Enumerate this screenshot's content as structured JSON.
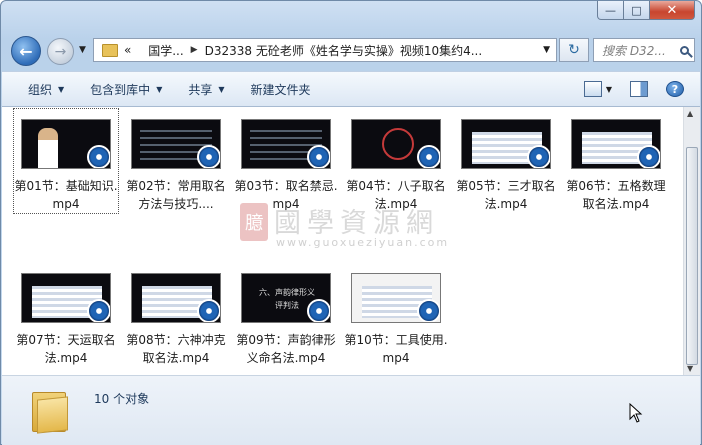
{
  "window": {
    "buttons": {
      "minimize": "—",
      "maximize": "□",
      "close": "✕"
    }
  },
  "nav": {
    "back_icon": "back-arrow-icon",
    "forward_icon": "forward-arrow-icon",
    "breadcrumb_prefix": "«",
    "crumbs": [
      "国学...",
      "D32338 无砼老师《姓名学与实操》视频10集约4..."
    ],
    "search_placeholder": "搜索 D32..."
  },
  "toolbar": {
    "organize": "组织",
    "include_library": "包含到库中",
    "share": "共享",
    "new_folder": "新建文件夹"
  },
  "files": [
    {
      "label": "第01节：基础知识.mp4",
      "style": "person"
    },
    {
      "label": "第02节：常用取名方法与技巧....",
      "style": "text"
    },
    {
      "label": "第03节：取名禁忌.mp4",
      "style": "text"
    },
    {
      "label": "第04节：八子取名法.mp4",
      "style": "circle"
    },
    {
      "label": "第05节：三才取名法.mp4",
      "style": "table"
    },
    {
      "label": "第06节：五格数理取名法.mp4",
      "style": "table"
    },
    {
      "label": "第07节：天运取名法.mp4",
      "style": "table"
    },
    {
      "label": "第08节：六神冲克取名法.mp4",
      "style": "table"
    },
    {
      "label": "第09节：声韵律形义命名法.mp4",
      "style": "title"
    },
    {
      "label": "第10节：工具使用.mp4",
      "style": "light"
    }
  ],
  "thumb_title_text": "六、声韵律形义\n评判法",
  "watermark": {
    "seal": "臆",
    "chinese": "國學資源網",
    "url": "www.guoxueziyuan.com"
  },
  "status": {
    "count": "10 个对象"
  }
}
